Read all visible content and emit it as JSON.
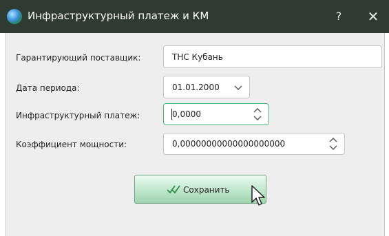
{
  "window": {
    "title": "Инфраструктурный платеж и КМ",
    "help_label": "?",
    "close_label": "✕"
  },
  "form": {
    "supplier_label": "Гарантирующий поставщик:",
    "supplier_value": "ТНС Кубань",
    "date_label": "Дата периода:",
    "date_value": "01.01.2000",
    "payment_label": "Инфраструктурный платеж:",
    "payment_value": "0,0000",
    "coef_label": "Коэффициент мощности:",
    "coef_value": "0,00000000000000000000"
  },
  "actions": {
    "save_label": "Сохранить"
  },
  "colors": {
    "titlebar": "#2f3a32",
    "button_green": "#bfe7cb",
    "focus_border": "#4eb277"
  },
  "icons": {
    "app": "globe-icon",
    "save": "double-check-icon",
    "date_dropdown": "chevron-down-icon",
    "spinner": "spin-up-down-icon",
    "cursor": "mouse-pointer-icon"
  }
}
